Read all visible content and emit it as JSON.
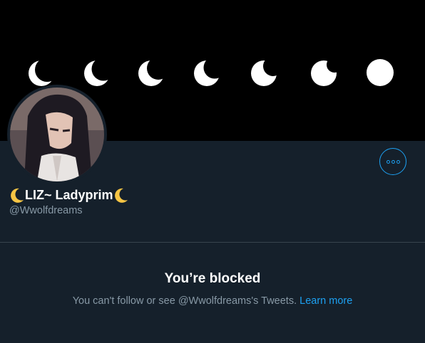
{
  "profile": {
    "display_name": "LIZ~ Ladyprim",
    "handle": "@Wwolfdreams",
    "banner_icon": "moon-phases",
    "avatar_icon": "anime-avatar"
  },
  "blocked": {
    "title": "You’re blocked",
    "message": "You can't follow or see @Wwolfdreams's Tweets.",
    "link": "Learn more"
  },
  "colors": {
    "background": "#15202b",
    "accent": "#1da1f2",
    "muted_text": "#8899a6",
    "banner": "#000000"
  }
}
